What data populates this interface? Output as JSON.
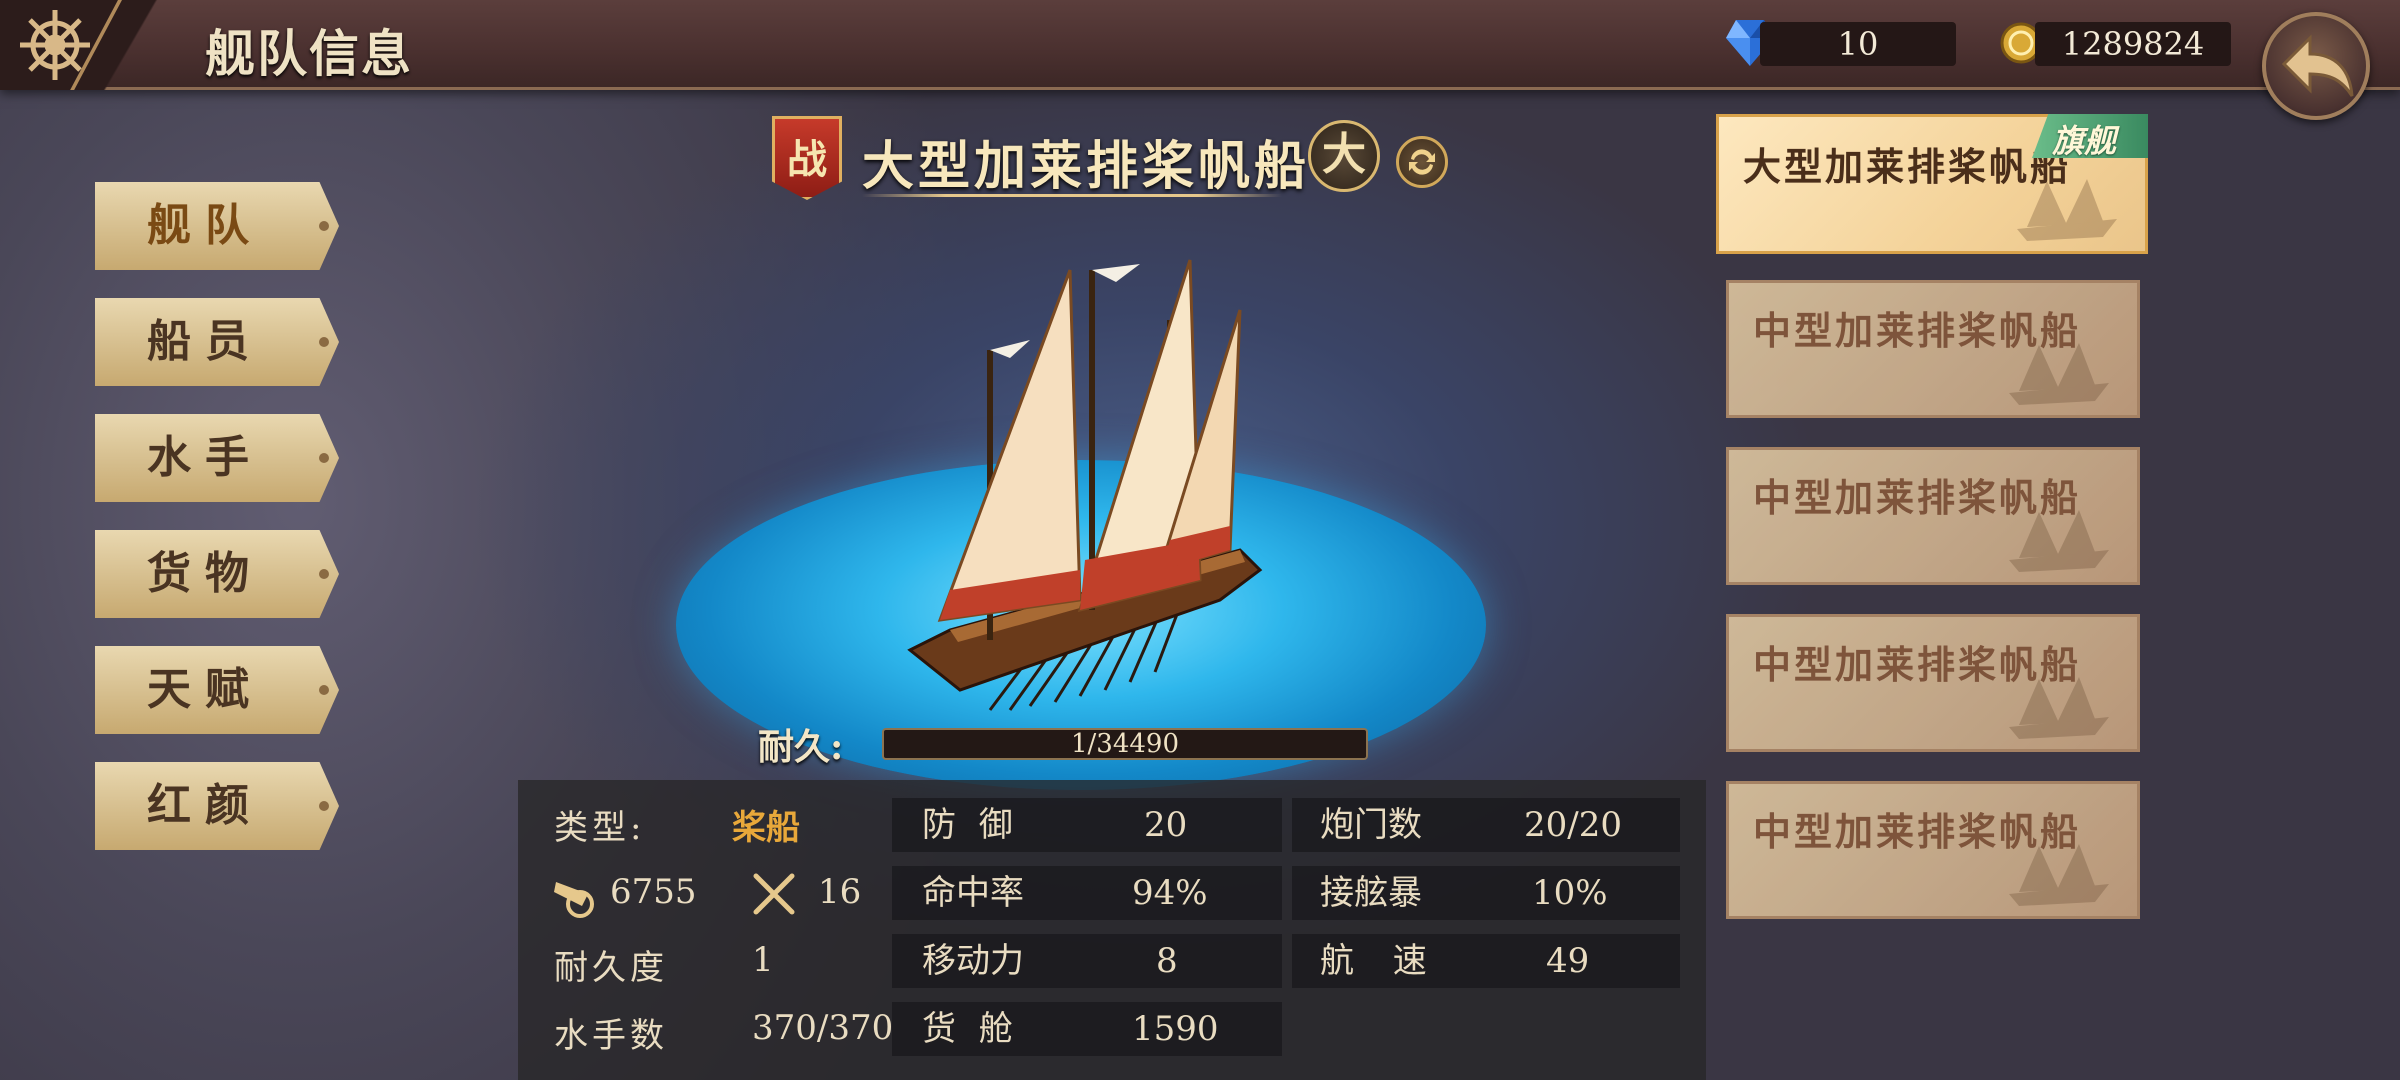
{
  "header": {
    "title": "舰队信息",
    "gems": "10",
    "coins": "1289824"
  },
  "menu": [
    {
      "label": "舰队",
      "active": true
    },
    {
      "label": "船员",
      "active": false
    },
    {
      "label": "水手",
      "active": false
    },
    {
      "label": "货物",
      "active": false
    },
    {
      "label": "天赋",
      "active": false
    },
    {
      "label": "红颜",
      "active": false
    }
  ],
  "ship": {
    "badge": "战",
    "name": "大型加莱排桨帆船",
    "size_badge": "大",
    "durability_label": "耐久:",
    "durability_text": "1/34490",
    "durability_fraction": 3e-05
  },
  "stats": {
    "type_label": "类型:",
    "type_value": "桨船",
    "firepower": "6755",
    "melee": "16",
    "durability_label": "耐久度",
    "durability_value": "1",
    "sailors_label": "水手数",
    "sailors_value": "370/370",
    "defense_label": "防 御",
    "defense_value": "20",
    "accuracy_label": "命中率",
    "accuracy_value": "94%",
    "mobility_label": "移动力",
    "mobility_value": "8",
    "cargo_label": "货 舱",
    "cargo_value": "1590",
    "cannon_label": "炮门数",
    "cannon_value": "20/20",
    "boarding_label": "接舷暴",
    "boarding_value": "10%",
    "speed_label": "航 速",
    "speed_value": "49"
  },
  "fleet": {
    "flag_label": "旗舰",
    "ships": [
      {
        "name": "大型加莱排桨帆船",
        "flagship": true
      },
      {
        "name": "中型加莱排桨帆船",
        "flagship": false
      },
      {
        "name": "中型加莱排桨帆船",
        "flagship": false
      },
      {
        "name": "中型加莱排桨帆船",
        "flagship": false
      },
      {
        "name": "中型加莱排桨帆船",
        "flagship": false
      }
    ]
  },
  "colors": {
    "accent_gold": "#e6c88c",
    "type_orange": "#e8a83a",
    "flag_green": "#3a8a60",
    "sea_blue": "#2fb7ec"
  }
}
